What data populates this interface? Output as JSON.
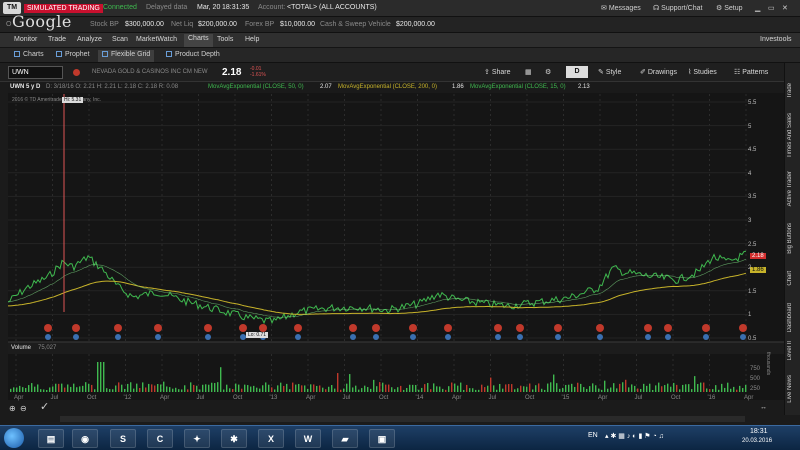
{
  "topbar": {
    "brand": "TM",
    "mode": "SIMULATED TRADING",
    "connection": "Connected",
    "data_status": "Delayed data",
    "date": "Mar, 20",
    "time": "18:31:35",
    "account_label": "Account:",
    "account_value": "<TOTAL> (ALL ACCOUNTS)",
    "messages": "Messages",
    "support": "Support/Chat",
    "setup": "Setup"
  },
  "account": {
    "watermark": "Google",
    "stock_bp_label": "Stock BP",
    "stock_bp_value": "$300,000.00",
    "net_liq_label": "Net Liq",
    "net_liq_value": "$200,000.00",
    "forex_bp_label": "Forex BP",
    "forex_bp_value": "$10,000.00",
    "cash_label": "Cash & Sweep Vehicle",
    "cash_value": "$200,000.00"
  },
  "menu": {
    "items": [
      "Monitor",
      "Trade",
      "Analyze",
      "Scan",
      "MarketWatch",
      "Charts",
      "Tools",
      "Help"
    ],
    "right": "Investools"
  },
  "subtabs": [
    "Charts",
    "Prophet",
    "Flexible Grid",
    "Product Depth"
  ],
  "symbol": {
    "ticker": "UWN",
    "company": "NEVADA GOLD & CASINOS INC CM NEW",
    "last": "2.18",
    "change": "-0.01",
    "change_pct": "-1.61%",
    "share": "Share",
    "timeframe_badge": "D",
    "style": "Style",
    "drawings": "Drawings",
    "studies": "Studies",
    "patterns": "Patterns"
  },
  "studies": {
    "header": "UWN 5 y D",
    "ohlc": "D: 3/18/16   O: 2.21   H: 2.21   L: 2.18   C: 2.18   R: 0.08",
    "ema50_label": "MovAvgExponential (CLOSE, 50, 0)",
    "ema50_val": "2.07",
    "ema200_label": "MovAvgExponential (CLOSE, 200, 0)",
    "ema200_val": "1.86",
    "ema15_label": "MovAvgExponential (CLOSE, 15, 0)",
    "ema15_val": "2.13",
    "copyright": "2016 © TD Ameritrade IP Company, Inc.",
    "hi_label": "Hi: 5.31",
    "lo_label": "Lo: 0.71"
  },
  "price_axis": [
    "5.5",
    "5",
    "4.5",
    "4",
    "3.5",
    "3",
    "2.5",
    "2",
    "1.5",
    "1",
    "0.5"
  ],
  "price_tags": {
    "last": "2.18",
    "ema": "1.86"
  },
  "volume": {
    "label": "Volume",
    "value": "75,027",
    "axis": [
      "750",
      "500",
      "250"
    ],
    "unit": "thousands"
  },
  "x_axis": [
    "Apr",
    "Jul",
    "Oct",
    "'12",
    "Apr",
    "Jul",
    "Oct",
    "'13",
    "Apr",
    "Jul",
    "Oct",
    "'14",
    "Apr",
    "Jul",
    "Oct",
    "'15",
    "Apr",
    "Jul",
    "Oct",
    "'16",
    "Apr"
  ],
  "side_tabs": [
    "Trade",
    "Times And Sales",
    "Active Trader",
    "Big Buttons",
    "Chart",
    "Dashboard",
    "Level II",
    "Live News"
  ],
  "taskbar": {
    "lang": "EN",
    "time": "18:31",
    "date": "20.03.2016"
  },
  "colors": {
    "price": "#3fb94f",
    "ema_slow": "#c7b32a",
    "volume": "#3fb94f",
    "accent_red": "#c8102e"
  }
}
